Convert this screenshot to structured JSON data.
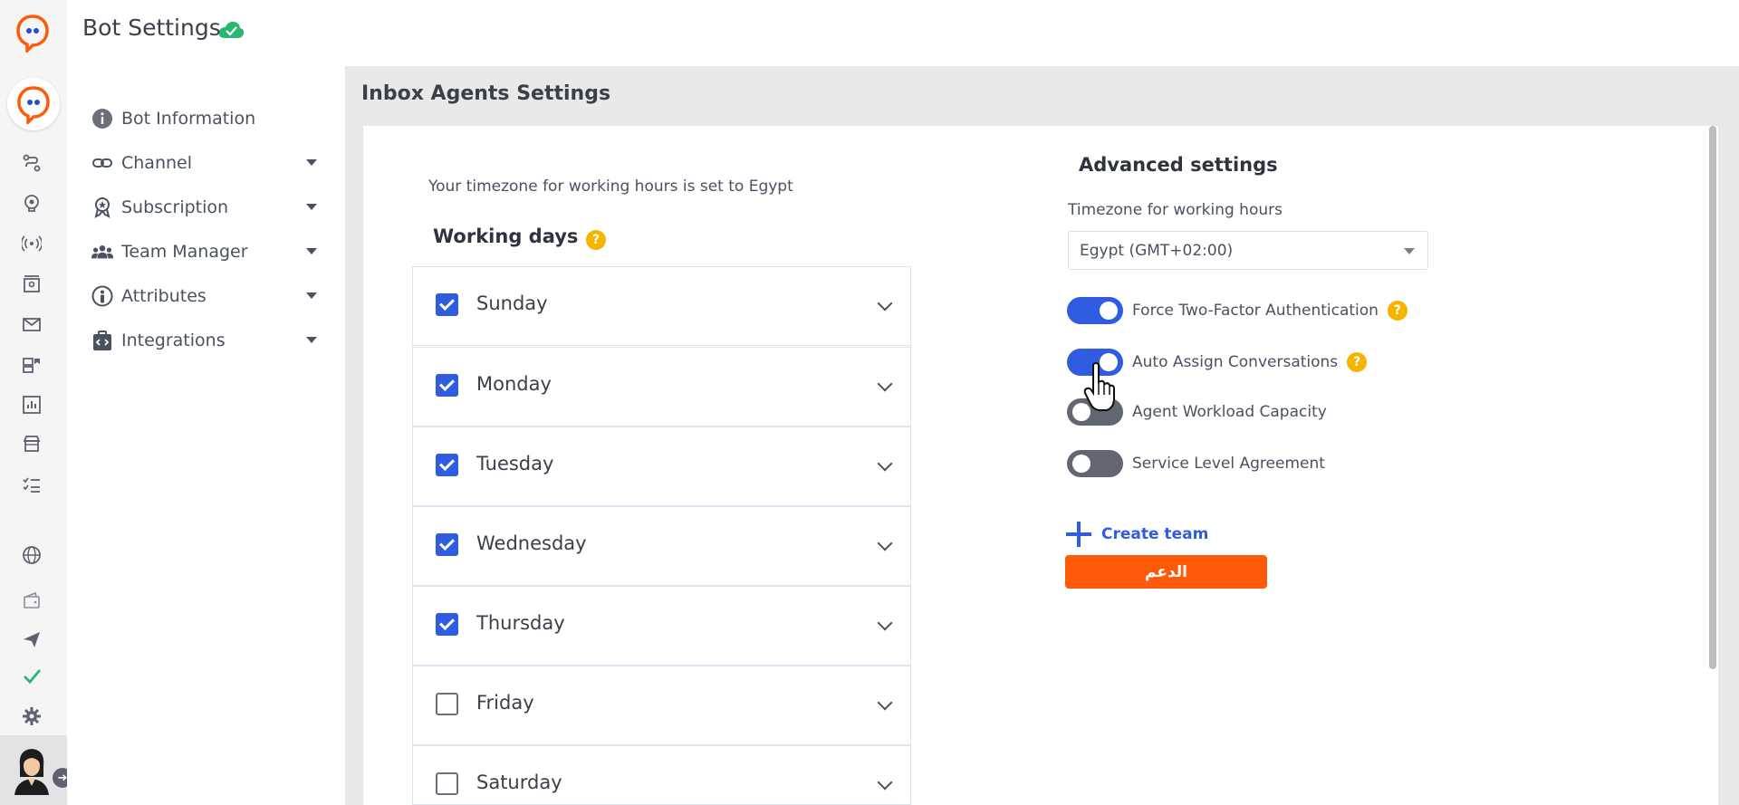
{
  "header": {
    "title": "Bot Settings",
    "status_icon": "cloud-check-icon"
  },
  "sidebar": {
    "items": [
      {
        "label": "Bot Information",
        "icon": "info-icon",
        "has_caret": false
      },
      {
        "label": "Channel",
        "icon": "link-icon",
        "has_caret": true
      },
      {
        "label": "Subscription",
        "icon": "award-icon",
        "has_caret": true
      },
      {
        "label": "Team Manager",
        "icon": "team-icon",
        "has_caret": true
      },
      {
        "label": "Attributes",
        "icon": "person-icon",
        "has_caret": true
      },
      {
        "label": "Integrations",
        "icon": "integration-icon",
        "has_caret": true
      }
    ]
  },
  "rail": {
    "icons": [
      "flow-icon",
      "brain-icon",
      "broadcast-icon",
      "contacts-icon",
      "mail-icon",
      "templates-icon",
      "analytics-icon",
      "store-icon",
      "tasks-icon",
      "globe-icon",
      "wallet-icon",
      "send-icon",
      "check-icon",
      "gear-icon"
    ]
  },
  "main": {
    "title": "Inbox Agents Settings",
    "timezone_note": "Your timezone for working hours is set to Egypt",
    "working_days_title": "Working days",
    "days": [
      {
        "name": "Sunday",
        "checked": true
      },
      {
        "name": "Monday",
        "checked": true
      },
      {
        "name": "Tuesday",
        "checked": true
      },
      {
        "name": "Wednesday",
        "checked": true
      },
      {
        "name": "Thursday",
        "checked": true
      },
      {
        "name": "Friday",
        "checked": false
      },
      {
        "name": "Saturday",
        "checked": false
      }
    ],
    "advanced": {
      "title": "Advanced settings",
      "timezone_label": "Timezone for working hours",
      "timezone_value": "Egypt (GMT+02:00)",
      "toggles": [
        {
          "label": "Force Two-Factor Authentication",
          "on": true,
          "help": true
        },
        {
          "label": "Auto Assign Conversations",
          "on": true,
          "help": true
        },
        {
          "label": "Agent Workload Capacity",
          "on": false,
          "help": false
        },
        {
          "label": "Service Level Agreement",
          "on": false,
          "help": false
        }
      ],
      "create_team_label": "Create team",
      "support_button_label": "الدعم"
    },
    "help_glyph": "?"
  },
  "colors": {
    "accent": "#2f5ce0",
    "brand_orange": "#ff5a0a",
    "help_yellow": "#f4b400",
    "success_green": "#2bb673"
  }
}
